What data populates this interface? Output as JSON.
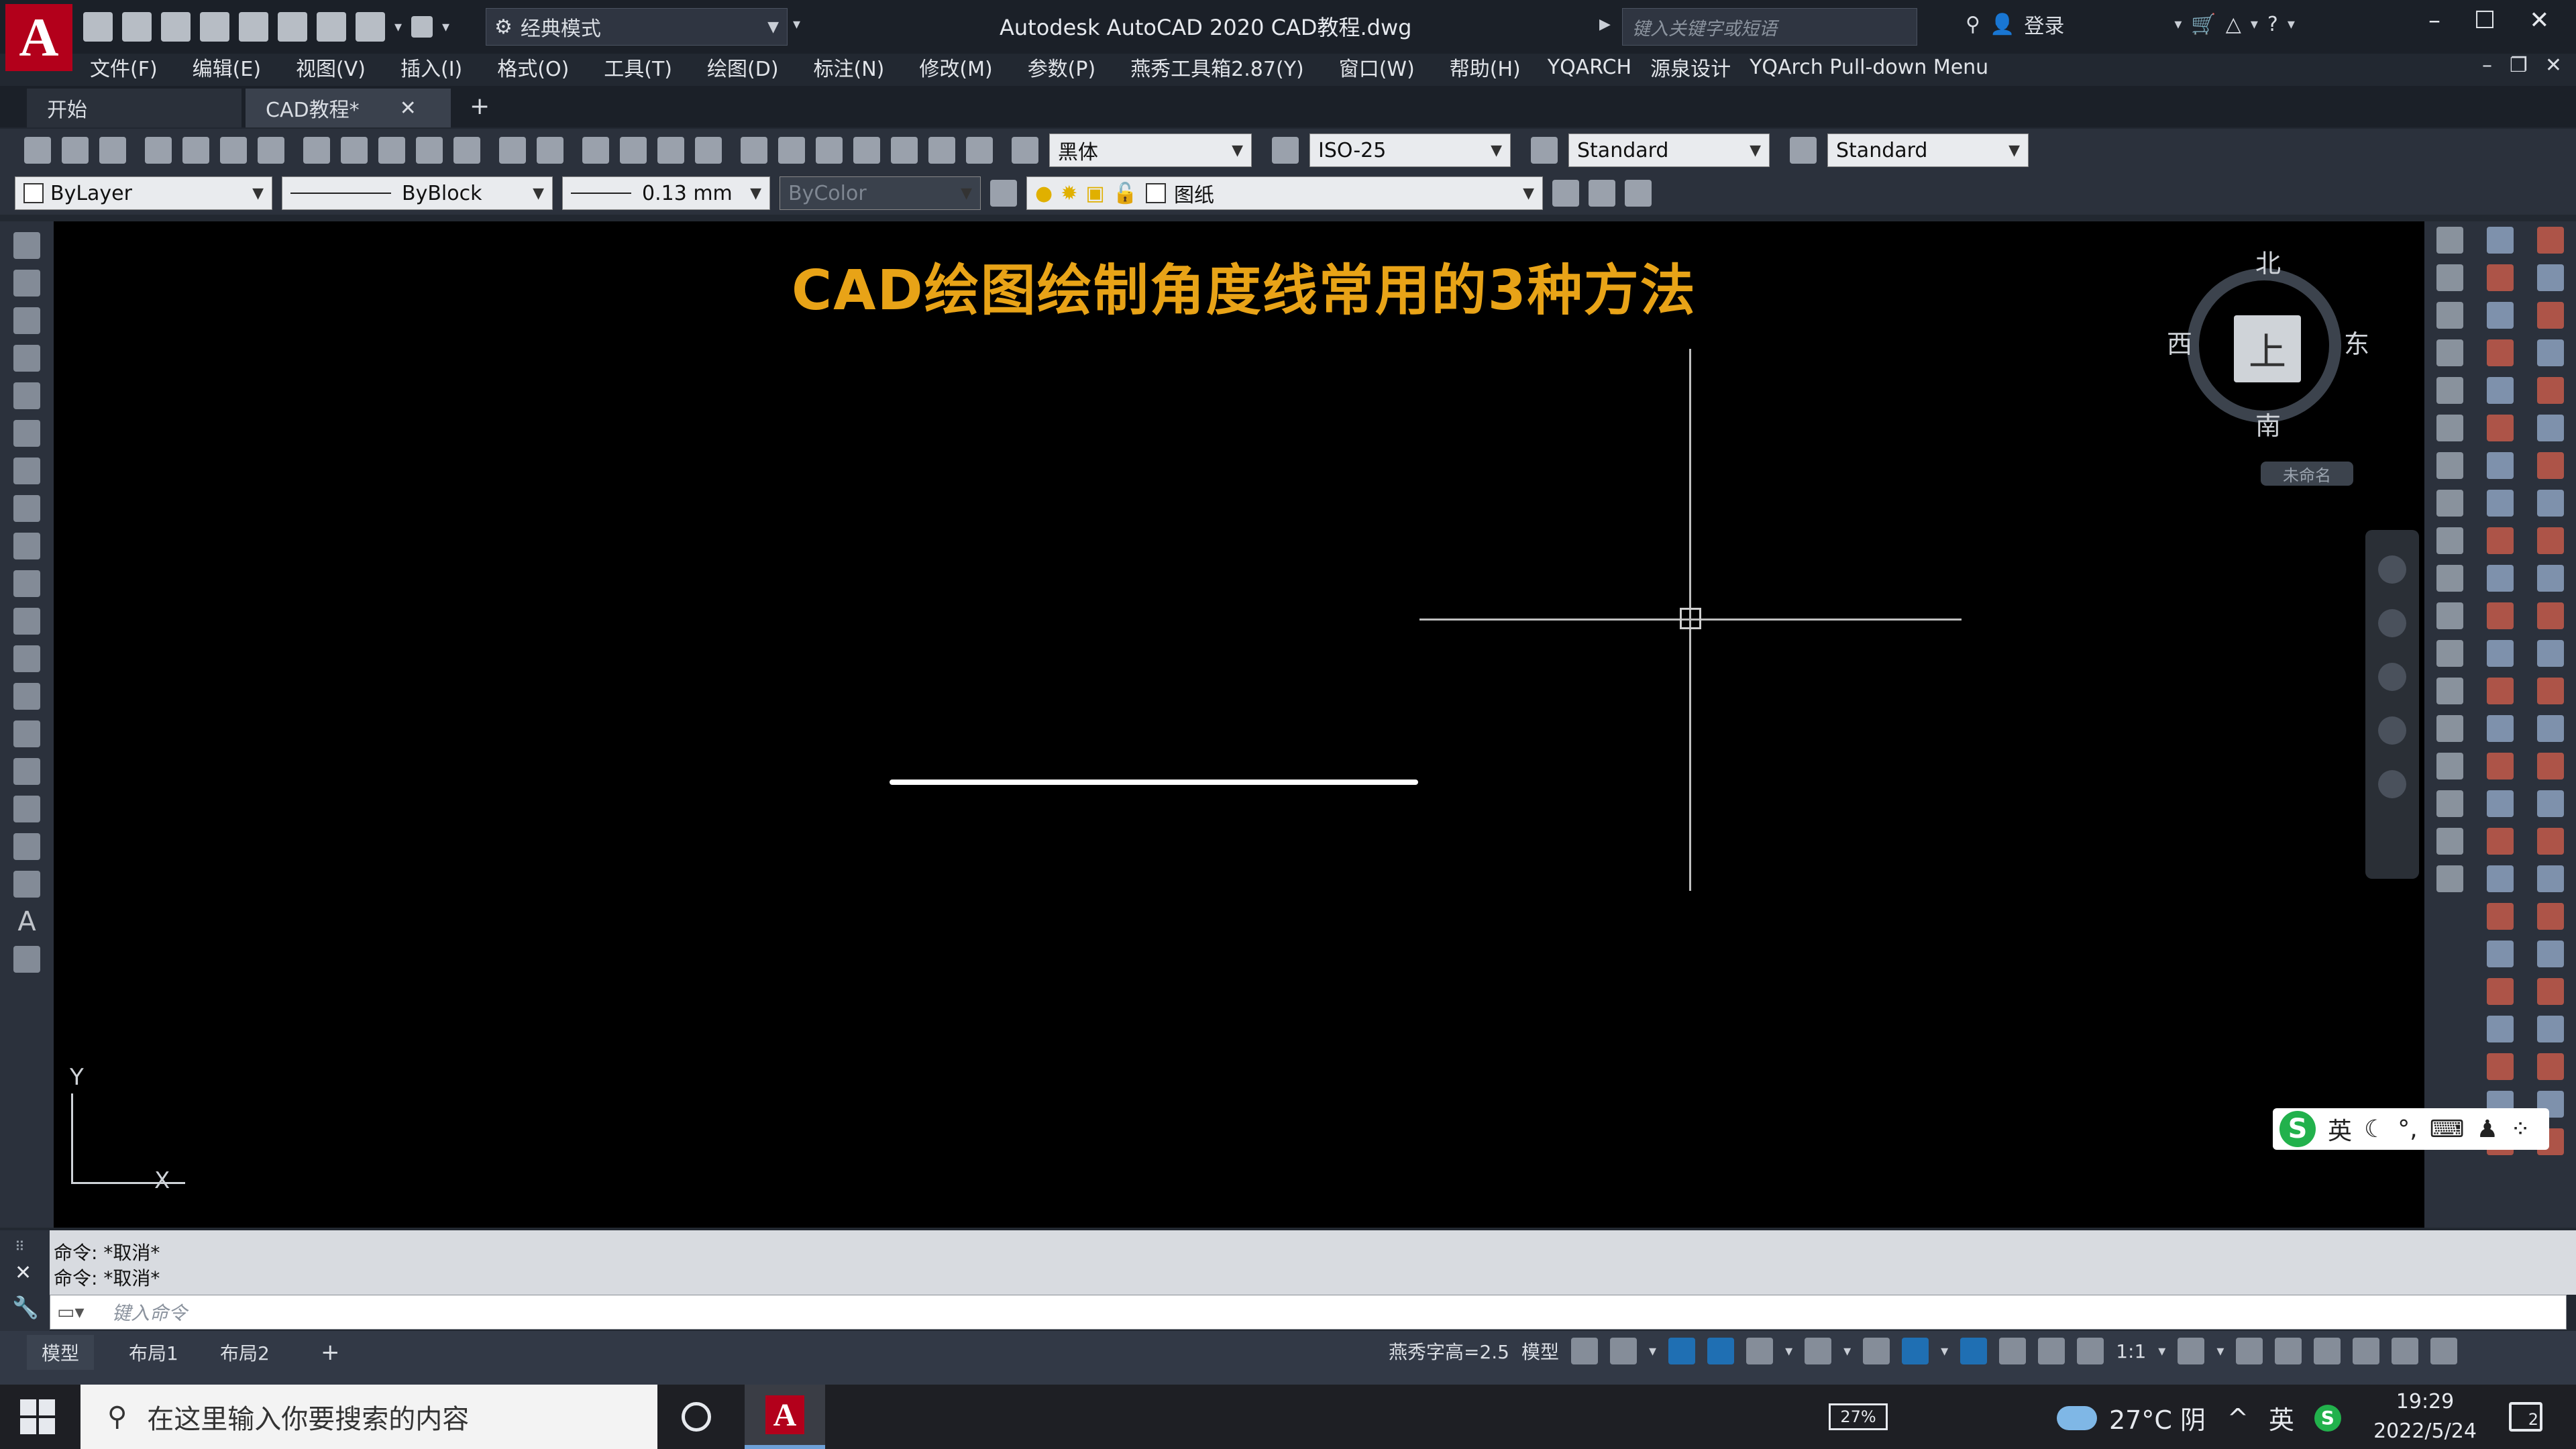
{
  "app": {
    "logo_letter": "A",
    "workspace": "经典模式",
    "title": "Autodesk AutoCAD 2020    CAD教程.dwg",
    "search_placeholder": "键入关键字或短语",
    "login": "登录"
  },
  "menu": [
    "文件(F)",
    "编辑(E)",
    "视图(V)",
    "插入(I)",
    "格式(O)",
    "工具(T)",
    "绘图(D)",
    "标注(N)",
    "修改(M)",
    "参数(P)",
    "燕秀工具箱2.87(Y)",
    "窗口(W)",
    "帮助(H)",
    "YQARCH",
    "源泉设计",
    "YQArch Pull-down Menu"
  ],
  "tabs": {
    "start": "开始",
    "drawing": "CAD教程*",
    "close": "✕",
    "add": "+"
  },
  "toolbar": {
    "text_font": "黑体",
    "dim_style": "ISO-25",
    "table_style": "Standard",
    "mleader_style": "Standard",
    "color": "ByLayer",
    "linetype": "ByBlock",
    "lineweight": "0.13 mm",
    "plot_style": "ByColor",
    "layer": "图纸"
  },
  "canvas": {
    "headline": "CAD绘图绘制角度线常用的3种方法",
    "ucs_x": "X",
    "ucs_y": "Y"
  },
  "viewcube": {
    "face": "上",
    "north": "北",
    "south": "南",
    "west": "西",
    "east": "东",
    "ucs_menu": "未命名"
  },
  "ime": {
    "logo": "S",
    "lang": "英"
  },
  "command": {
    "history": [
      "命令: *取消*",
      "命令: *取消*"
    ],
    "placeholder": "键入命令"
  },
  "layout_tabs": [
    "模型",
    "布局1",
    "布局2"
  ],
  "status": {
    "text_height": "燕秀字高=2.5",
    "model": "模型",
    "scale": "1:1"
  },
  "taskbar": {
    "search_placeholder": "在这里输入你要搜索的内容",
    "battery": "27%",
    "weather": "27°C 阴",
    "tray_lang": "英",
    "time": "19:29",
    "date": "2022/5/24",
    "notifications": "2"
  }
}
